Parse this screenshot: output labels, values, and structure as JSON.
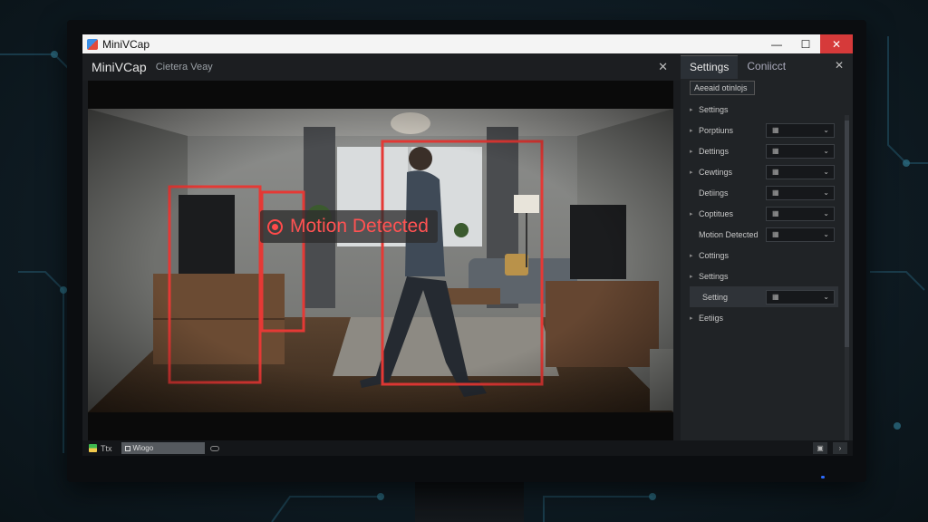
{
  "window": {
    "title": "MiniVCap",
    "controls": {
      "minimize": "—",
      "maximize": "☐",
      "close": "✕"
    }
  },
  "app_header": {
    "app_name": "MiniVCap",
    "view_label": "Cietera Veay",
    "close": "✕"
  },
  "viewer": {
    "motion_text": "Motion Detected",
    "box_color": "#e53935"
  },
  "panel": {
    "tabs": [
      {
        "label": "Settings",
        "active": true
      },
      {
        "label": "Coniicct",
        "active": false
      }
    ],
    "close": "✕",
    "subheader": "Aeeaid otinlojs",
    "rows": [
      {
        "label": "Settings",
        "arrow": "▸",
        "dropdown": null
      },
      {
        "label": "Porptiuns",
        "arrow": "▸",
        "dropdown": "▦"
      },
      {
        "label": "Dettings",
        "arrow": "▸",
        "dropdown": "▦"
      },
      {
        "label": "Cewtings",
        "arrow": "▸",
        "dropdown": "▦"
      },
      {
        "label": "Detiings",
        "arrow": "",
        "dropdown": "▦"
      },
      {
        "label": "Coptitues",
        "arrow": "▸",
        "dropdown": "▦"
      },
      {
        "label": "Motion Detected",
        "arrow": "",
        "dropdown": "▦"
      },
      {
        "label": "Cottings",
        "arrow": "▸",
        "dropdown": null
      },
      {
        "label": "Settings",
        "arrow": "▸",
        "dropdown": null
      },
      {
        "label": "Setting",
        "arrow": "",
        "dropdown": "▦",
        "highlight": true
      },
      {
        "label": "Eetiigs",
        "arrow": "▸",
        "dropdown": null
      }
    ]
  },
  "statusbar": {
    "left_text": "Ttx",
    "field_text": "Wiogo"
  }
}
